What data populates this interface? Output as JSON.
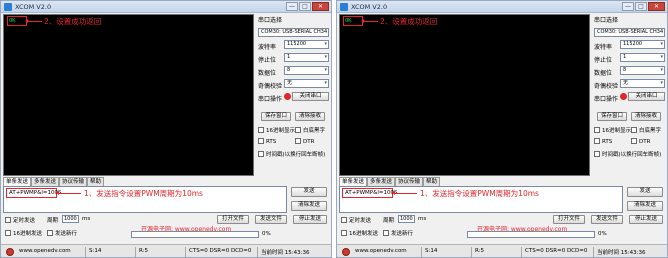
{
  "app": {
    "title": "XCOM V2.0"
  },
  "window_controls": {
    "minimize": "—",
    "maximize": "□",
    "close": "✕"
  },
  "receive": {
    "content": "OK",
    "note": "2、设置成功返回"
  },
  "side": {
    "port_select_label": "串口选择",
    "port": "COM30: USB-SERIAL CH34",
    "baud_label": "波特率",
    "baud": "115200",
    "stop_label": "停止位",
    "stop": "1",
    "data_label": "数据位",
    "data": "8",
    "parity_label": "奇偶校验",
    "parity": "无",
    "op_label": "串口操作",
    "op_button": "关闭串口",
    "save_window": "保存窗口",
    "clear_receive": "清除接收",
    "hex_display": "16进制显示",
    "white_bg": "白底黑字",
    "rts": "RTS",
    "dtr": "DTR",
    "timestamp": "时间戳(以换行回车断帧)"
  },
  "tabs": [
    "单条发送",
    "多条发送",
    "协议传输",
    "帮助"
  ],
  "send": {
    "command": "AT+PWMP&l=100S",
    "note": "1、发送指令设置PWM周期为10ms",
    "send_button": "发送",
    "clear_send_button": "清除发送"
  },
  "bottom": {
    "timed_send": "定时发送",
    "period_label": "周期",
    "period": "1000",
    "ms": "ms",
    "hex_send": "16进制发送",
    "newline": "发送新行",
    "open_file": "打开文件",
    "send_file": "发送文件",
    "stop_send": "停止发送",
    "site_text": "开源电子网: www.openedv.com",
    "progress": 0,
    "progress_text": "0%"
  },
  "status": {
    "url": "www.openedv.com",
    "s": "S:14",
    "r": "R:5",
    "signals": "CTS=0 DSR=0 DCD=0",
    "time": "当前时间 15:43:36"
  },
  "colors": {
    "accent": "#e3262b",
    "ok_text": "#29d649"
  }
}
